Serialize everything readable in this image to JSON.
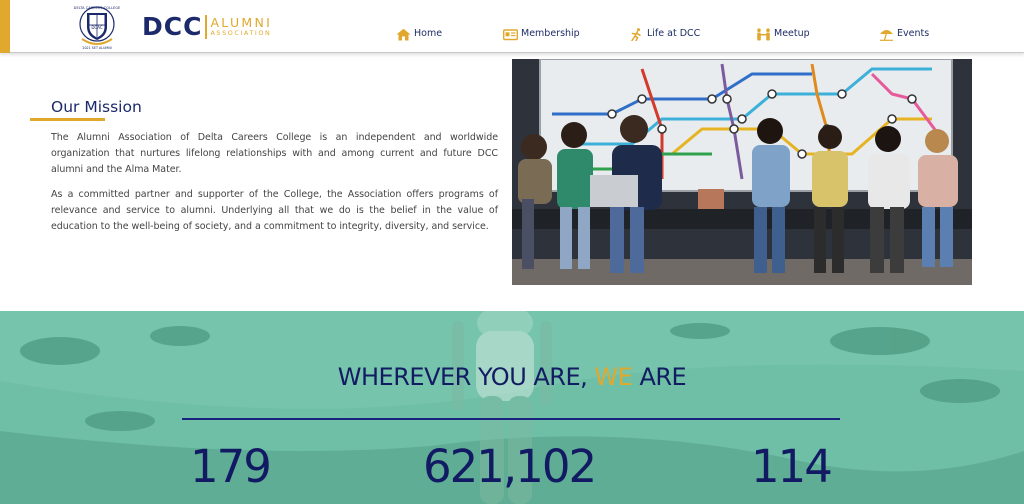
{
  "header": {
    "crest_text": "DELTA CAREERS COLLEGE",
    "crest_letters": "DCAC",
    "crest_footer": "2021 SET ALUMNI",
    "brand_dcc": "DCC",
    "brand_alumni": "ALUMNI",
    "brand_association": "ASSOCIATION",
    "accent_color": "#e0a92e",
    "brand_color": "#1c2a6b"
  },
  "nav": [
    {
      "label": "Home",
      "icon": "home-icon"
    },
    {
      "label": "Membership",
      "icon": "id-card-icon"
    },
    {
      "label": "Life at DCC",
      "icon": "running-person-icon"
    },
    {
      "label": "Meetup",
      "icon": "people-icon"
    },
    {
      "label": "Events",
      "icon": "beach-umbrella-icon"
    }
  ],
  "mission": {
    "title": "Our Mission",
    "p1": "The Alumni Association of Delta Careers College is an independent and worldwide organization that nurtures lifelong relationships with and among current and future DCC alumni and the Alma Mater.",
    "p2": "As a committed partner and supporter of the College, the Association offers programs of relevance and service to alumni. Underlying all that we do is the belief in the value of education to the well-being of society, and a commitment to integrity, diversity, and service."
  },
  "stats": {
    "title_before": "WHEREVER YOU ARE, ",
    "title_highlight": "WE",
    "title_after": " ARE",
    "numbers": [
      "179",
      "621,102",
      "114"
    ],
    "overlay_color": "#67b79f"
  }
}
